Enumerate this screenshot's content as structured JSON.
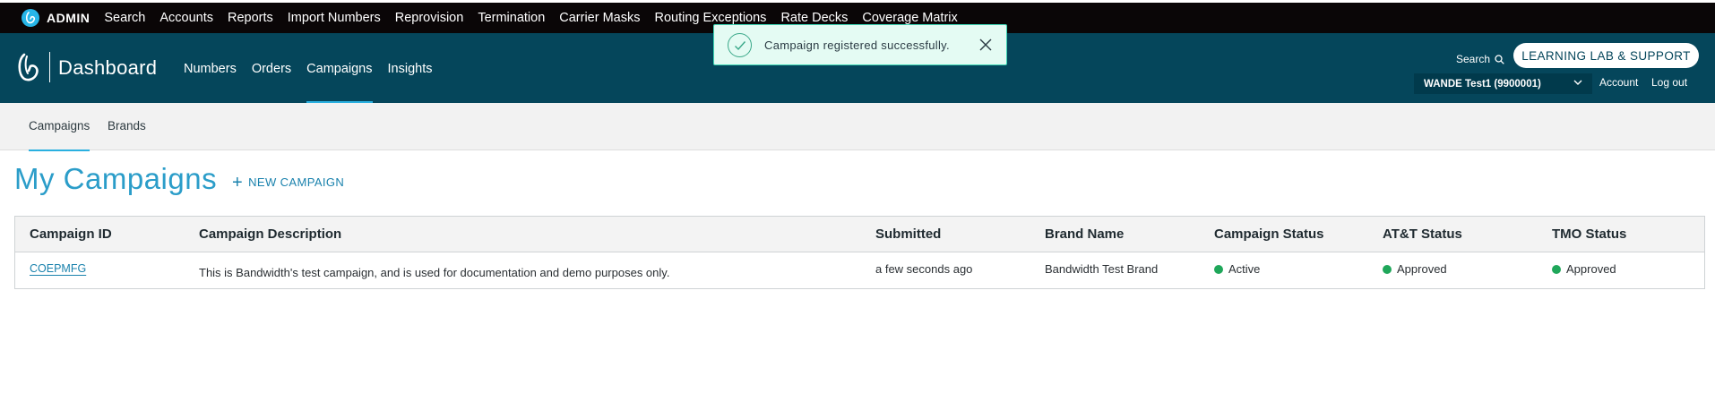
{
  "admin_bar": {
    "title": "ADMIN",
    "links": [
      "Search",
      "Accounts",
      "Reports",
      "Import Numbers",
      "Reprovision",
      "Termination",
      "Carrier Masks",
      "Routing Exceptions",
      "Rate Decks",
      "Coverage Matrix"
    ]
  },
  "header": {
    "brand_title": "Dashboard",
    "nav": [
      "Numbers",
      "Orders",
      "Campaigns",
      "Insights"
    ],
    "active_nav": "Campaigns",
    "search_label": "Search",
    "learning_lab_label": "LEARNING LAB & SUPPORT",
    "account_selected": "WANDE Test1 (9900001)",
    "account_link": "Account",
    "logout_link": "Log out"
  },
  "toast": {
    "message": "Campaign registered successfully."
  },
  "sub_nav": {
    "items": [
      "Campaigns",
      "Brands"
    ],
    "active": "Campaigns"
  },
  "page": {
    "title": "My Campaigns",
    "new_campaign_label": "NEW CAMPAIGN"
  },
  "table": {
    "columns": [
      "Campaign ID",
      "Campaign Description",
      "Submitted",
      "Brand Name",
      "Campaign Status",
      "AT&T Status",
      "TMO Status"
    ],
    "rows": [
      {
        "campaign_id": "COEPMFG",
        "description": "This is Bandwidth's test campaign, and is used for documentation and demo purposes only.",
        "submitted": "a few seconds ago",
        "brand_name": "Bandwidth Test Brand",
        "campaign_status": "Active",
        "att_status": "Approved",
        "tmo_status": "Approved"
      }
    ]
  },
  "colors": {
    "admin_bar": "#0a0607",
    "header": "#05465b",
    "accent": "#2b9dc9",
    "status_green": "#1fa75a",
    "toast_bg": "#e4fbf3"
  }
}
